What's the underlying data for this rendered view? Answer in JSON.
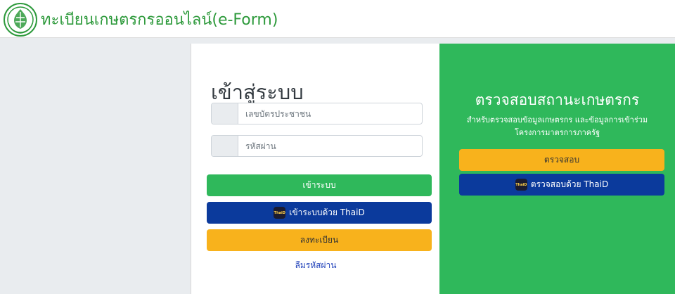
{
  "header": {
    "brand": "ทะเบียนเกษตรกรออนไลน์(e-Form)",
    "logo_icon": "ministry-seal-icon"
  },
  "login": {
    "title": "เข้าสู่ระบบ",
    "id_placeholder": "เลขบัตรประชาชน",
    "password_placeholder": "รหัสผ่าน",
    "login_button": "เข้าระบบ",
    "thaid_button": "เข้าระบบด้วย ThaiD",
    "register_button": "ลงทะเบียน",
    "forgot_link": "ลืมรหัสผ่าน"
  },
  "check": {
    "title": "ตรวจสอบสถานะเกษตรกร",
    "subtitle": "สำหรับตรวจสอบข้อมูลเกษตรกร และข้อมูลการเข้าร่วมโครงการมาตรการภาครัฐ",
    "check_button": "ตรวจสอบ",
    "thaid_button": "ตรวจสอบด้วย ThaiD"
  },
  "icons": {
    "thaid": "ThaiD"
  },
  "colors": {
    "brand_green": "#2e9a3c",
    "green": "#2fb85b",
    "blue": "#0b3a9c",
    "yellow": "#f8b21c",
    "link": "#1a3cb8"
  }
}
